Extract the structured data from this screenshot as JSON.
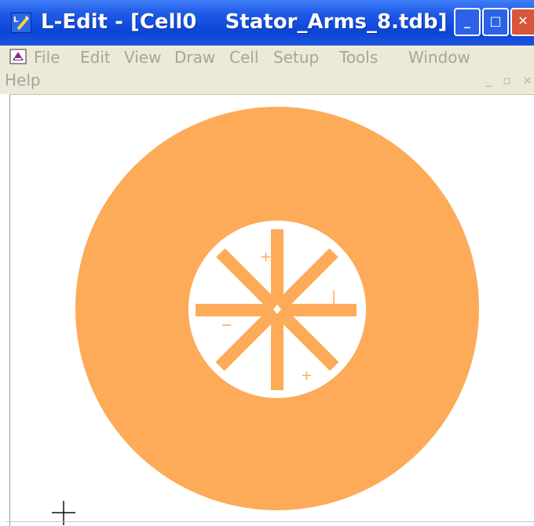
{
  "window": {
    "title": "L-Edit - [Cell0    Stator_Arms_8.tdb]",
    "buttons": {
      "minimize": "_",
      "maximize": "□",
      "close": "✕"
    }
  },
  "menu": {
    "items": [
      "File",
      "Edit",
      "View",
      "Draw",
      "Cell",
      "Setup",
      "Tools",
      "Window",
      "Help"
    ]
  },
  "mdi_controls": "_ ▫ ×",
  "layout": {
    "cursor_mark": "+",
    "labels": [
      {
        "text": "+"
      },
      {
        "text": "|"
      },
      {
        "text": "−"
      },
      {
        "text": "+"
      }
    ]
  },
  "colors": {
    "titlebar": "#0a45d8",
    "menubar": "#ece9d8",
    "layer_fill": "#fdab58",
    "background": "#ffffff"
  },
  "icons": {
    "app": "l-edit-logo-icon",
    "document": "layout-document-icon"
  }
}
